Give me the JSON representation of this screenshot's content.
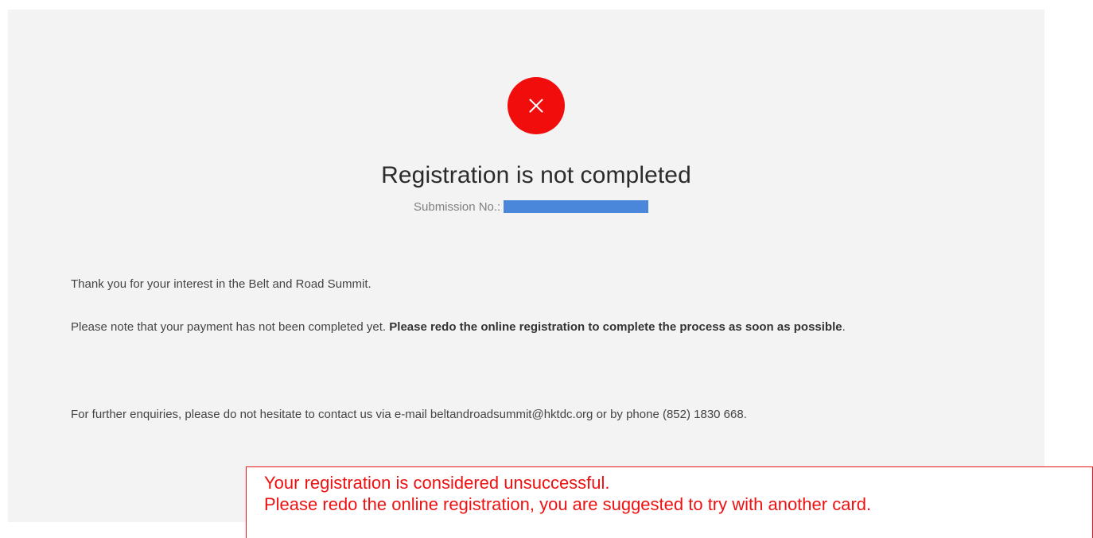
{
  "status": {
    "icon": "close-icon",
    "color": "#f20d0d",
    "title": "Registration is not completed",
    "submission_label": "Submission No.:"
  },
  "message": {
    "thanks": "Thank you for your interest in the Belt and Road Summit.",
    "payment_note_prefix": "Please note that your payment has not been completed yet. ",
    "payment_note_bold": "Please redo the online registration to complete the process as soon as possible",
    "payment_note_suffix": ".",
    "enquiries": "For further enquiries, please do not hesitate to contact us via e-mail beltandroadsummit@hktdc.org or by phone (852) 1830 668."
  },
  "annotation": {
    "line1": "Your registration is considered unsuccessful.",
    "line2": "Please redo the online registration, you are suggested to try with another card.",
    "color": "#ee1111"
  }
}
